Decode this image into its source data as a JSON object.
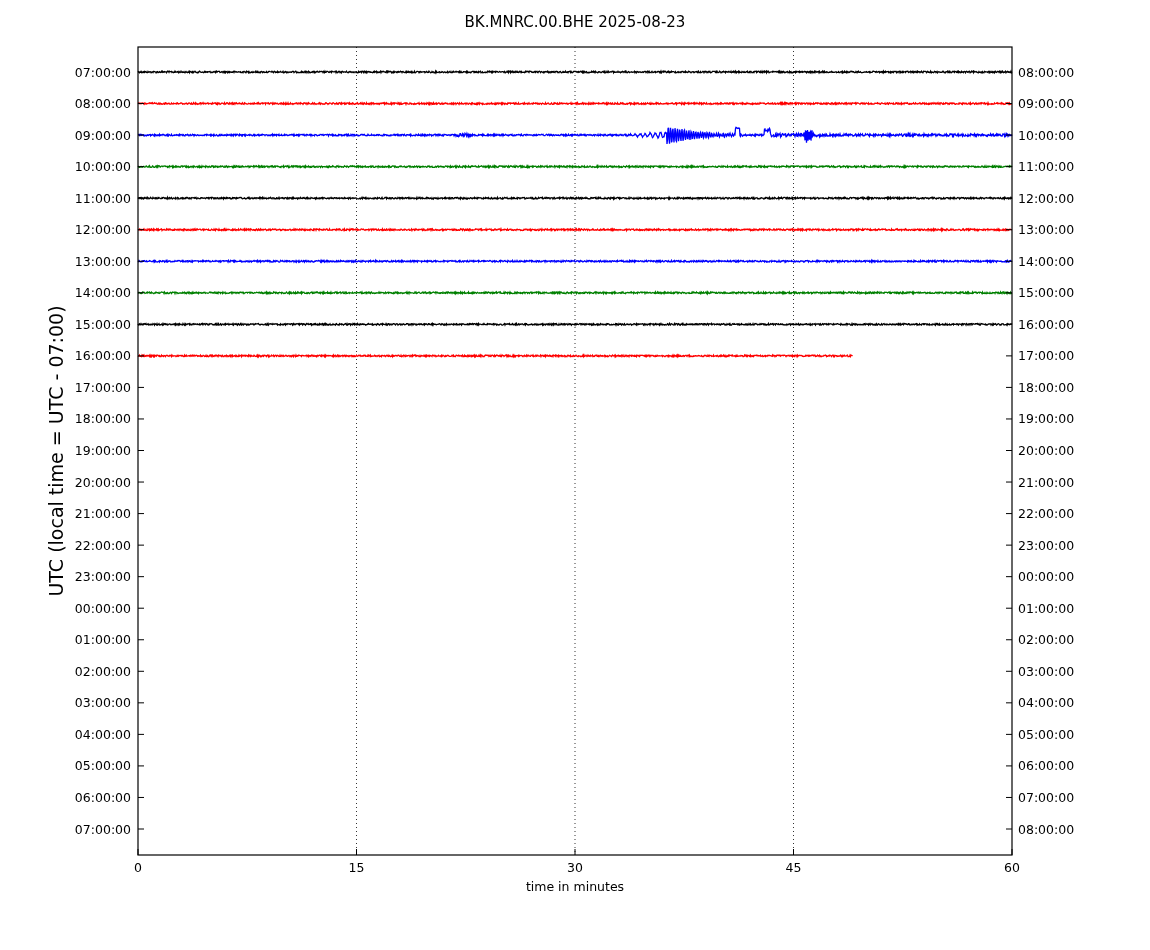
{
  "title": "BK.MNRC.00.BHE 2025-08-23",
  "y_axis_left": {
    "label": "UTC (local time = UTC - 07:00)",
    "ticks": [
      "07:00:00",
      "08:00:00",
      "09:00:00",
      "10:00:00",
      "11:00:00",
      "12:00:00",
      "13:00:00",
      "14:00:00",
      "15:00:00",
      "16:00:00",
      "17:00:00",
      "18:00:00",
      "19:00:00",
      "20:00:00",
      "21:00:00",
      "22:00:00",
      "23:00:00",
      "00:00:00",
      "01:00:00",
      "02:00:00",
      "03:00:00",
      "04:00:00",
      "05:00:00",
      "06:00:00",
      "07:00:00"
    ]
  },
  "y_axis_right": {
    "ticks": [
      "08:00:00",
      "09:00:00",
      "10:00:00",
      "11:00:00",
      "12:00:00",
      "13:00:00",
      "14:00:00",
      "15:00:00",
      "16:00:00",
      "17:00:00",
      "18:00:00",
      "19:00:00",
      "20:00:00",
      "21:00:00",
      "22:00:00",
      "23:00:00",
      "00:00:00",
      "01:00:00",
      "02:00:00",
      "03:00:00",
      "04:00:00",
      "05:00:00",
      "06:00:00",
      "07:00:00",
      "08:00:00"
    ]
  },
  "x_axis": {
    "label": "time in minutes",
    "ticks": [
      "0",
      "15",
      "30",
      "45",
      "60"
    ]
  },
  "traces": [
    {
      "kind": "noise",
      "color": "#000000",
      "level": 1
    },
    {
      "kind": "noise",
      "color": "#ff0000",
      "level": 1
    },
    {
      "kind": "event",
      "color": "#0000ff",
      "level": 1
    },
    {
      "kind": "noise",
      "color": "#008000",
      "level": 1
    },
    {
      "kind": "noise",
      "color": "#000000",
      "level": 1
    },
    {
      "kind": "noise",
      "color": "#ff0000",
      "level": 1
    },
    {
      "kind": "noise",
      "color": "#0000ff",
      "level": 1
    },
    {
      "kind": "noise",
      "color": "#008000",
      "level": 1
    },
    {
      "kind": "noise",
      "color": "#000000",
      "level": 1
    },
    {
      "kind": "noise",
      "color": "#ff0000",
      "level": 0.818
    }
  ]
}
